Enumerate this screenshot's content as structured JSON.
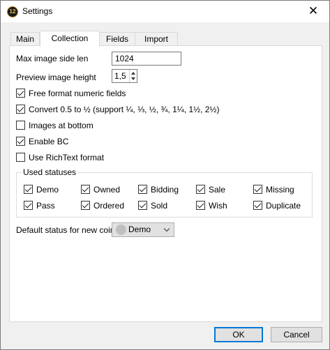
{
  "window": {
    "title": "Settings",
    "icon": "coin-app-icon",
    "icon_text": "12"
  },
  "tabs": [
    {
      "label": "Main"
    },
    {
      "label": "Collection",
      "active": true
    },
    {
      "label": "Fields"
    },
    {
      "label": "Import"
    }
  ],
  "fields": {
    "max_image_label": "Max image side len",
    "max_image_value": "1024",
    "preview_height_label": "Preview image height",
    "preview_height_value": "1,5"
  },
  "options": [
    {
      "label": "Free format numeric fields",
      "checked": true
    },
    {
      "label": "Convert 0.5 to ½ (support ¼, ⅓, ½, ¾, 1¼, 1½, 2½)",
      "checked": true
    },
    {
      "label": "Images at bottom",
      "checked": false
    },
    {
      "label": "Enable BC",
      "checked": true
    },
    {
      "label": "Use RichText format",
      "checked": false
    }
  ],
  "statuses": {
    "title": "Used statuses",
    "items": [
      {
        "label": "Demo",
        "checked": true
      },
      {
        "label": "Owned",
        "checked": true
      },
      {
        "label": "Bidding",
        "checked": true
      },
      {
        "label": "Sale",
        "checked": true
      },
      {
        "label": "Missing",
        "checked": true
      },
      {
        "label": "Pass",
        "checked": true
      },
      {
        "label": "Ordered",
        "checked": true
      },
      {
        "label": "Sold",
        "checked": true
      },
      {
        "label": "Wish",
        "checked": true
      },
      {
        "label": "Duplicate",
        "checked": true
      }
    ]
  },
  "default_status": {
    "label": "Default status for new coin",
    "value": "Demo"
  },
  "buttons": {
    "ok": "OK",
    "cancel": "Cancel"
  }
}
